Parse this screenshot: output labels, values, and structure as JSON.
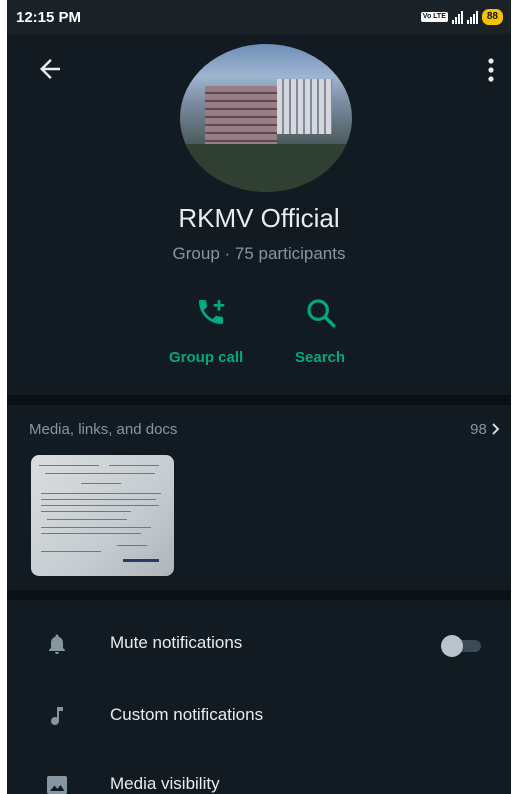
{
  "status_bar": {
    "time": "12:15 PM",
    "volte": "Vo LTE",
    "battery": "88"
  },
  "group": {
    "name": "RKMV Official",
    "subtitle": "Group · 75 participants"
  },
  "actions": [
    {
      "label": "Group call",
      "icon": "add-call-icon"
    },
    {
      "label": "Search",
      "icon": "search-icon"
    }
  ],
  "media": {
    "header": "Media, links, and docs",
    "count": "98"
  },
  "settings": [
    {
      "label": "Mute notifications",
      "icon": "bell-icon",
      "toggle": false
    },
    {
      "label": "Custom notifications",
      "icon": "music-note-icon"
    },
    {
      "label": "Media visibility",
      "icon": "image-icon"
    }
  ],
  "colors": {
    "accent": "#00a884",
    "background": "#121b22",
    "text_primary": "#e9edef",
    "text_secondary": "#8696a0"
  }
}
